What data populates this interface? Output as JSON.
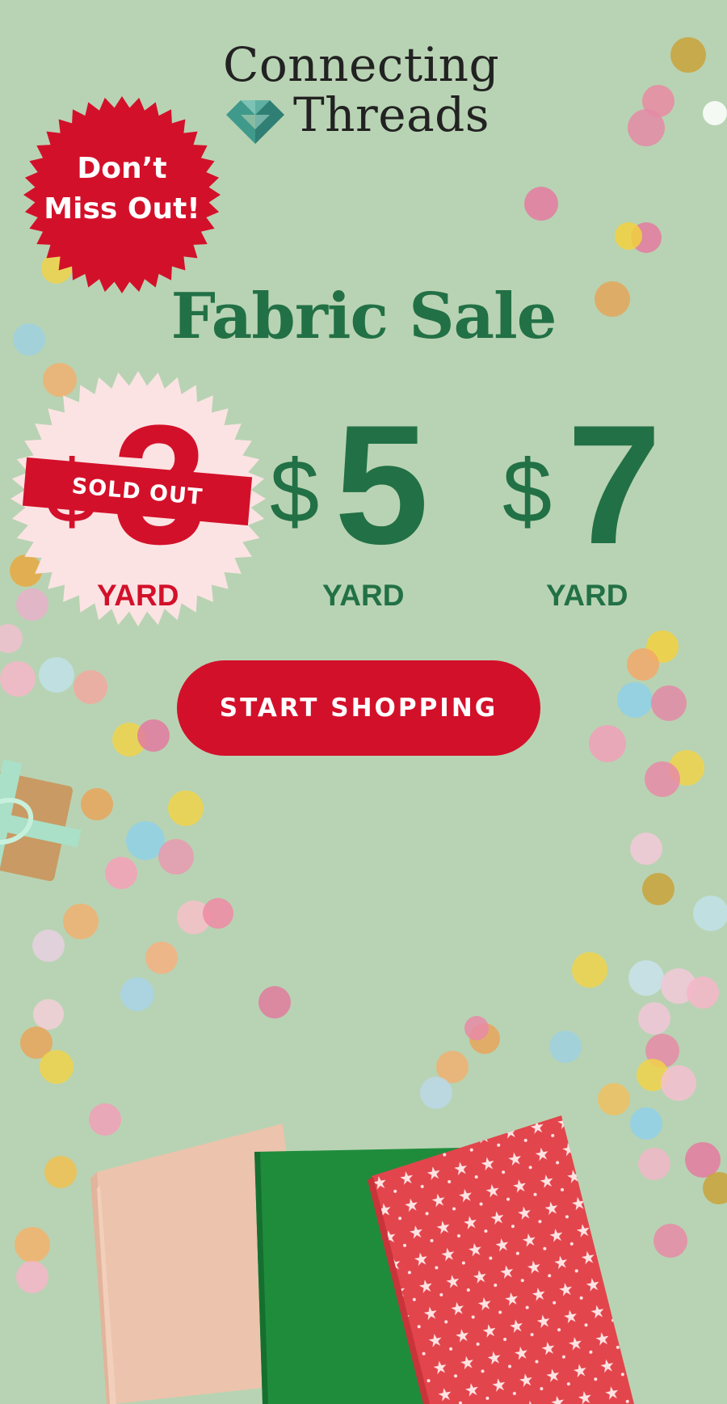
{
  "brand": {
    "line1": "Connecting",
    "line2": "Threads",
    "logo_icon": "heart-quilt-icon"
  },
  "badge": {
    "line1": "Don’t",
    "line2": "Miss Out!"
  },
  "headline": "Fabric Sale",
  "prices": [
    {
      "currency": "$",
      "amount": "3",
      "unit": "YARD",
      "status": "SOLD OUT"
    },
    {
      "currency": "$",
      "amount": "5",
      "unit": "YARD"
    },
    {
      "currency": "$",
      "amount": "7",
      "unit": "YARD"
    }
  ],
  "cta": {
    "label": "START SHOPPING"
  },
  "colors": {
    "background": "#b8d3b3",
    "brand_green": "#227046",
    "sale_red": "#d3102a",
    "sold_out_burst": "#fbe3e3",
    "logo_teal": "#4a9a8e"
  }
}
